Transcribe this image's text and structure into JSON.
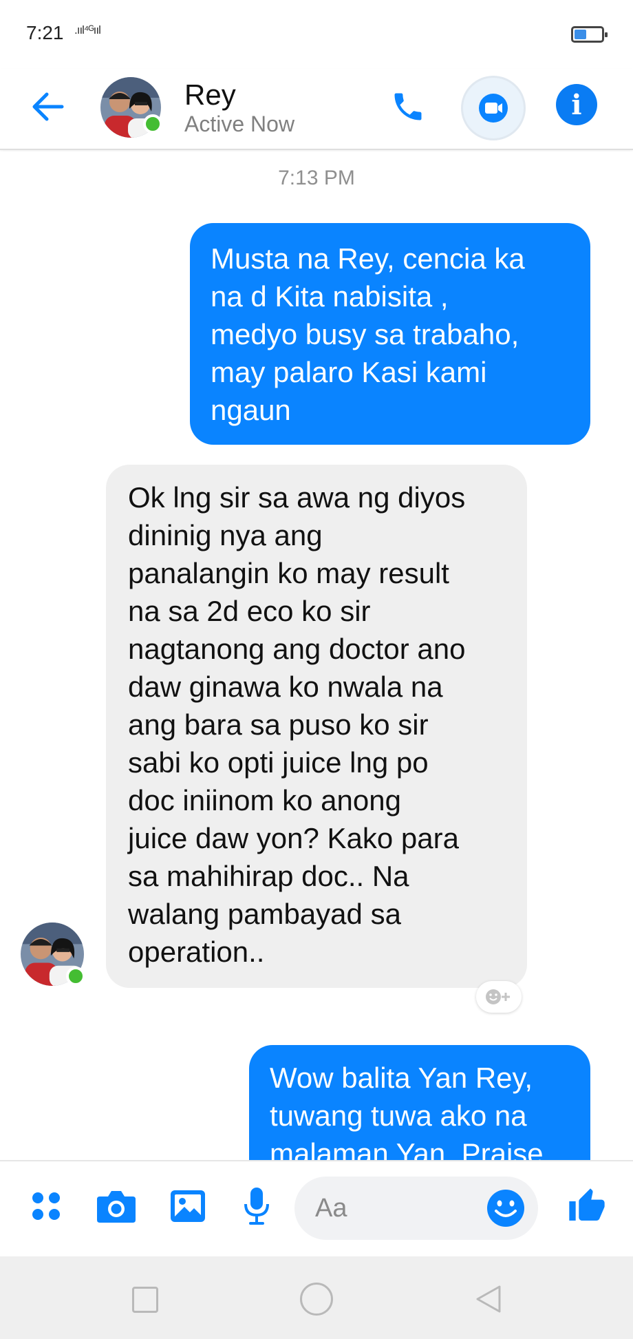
{
  "status_bar": {
    "time": "7:21",
    "signal": ".ııl⁴ᴳııl",
    "battery_level": 0.45
  },
  "header": {
    "contact_name": "Rey",
    "presence_status": "Active Now",
    "icons": {
      "back": "arrow-left-icon",
      "call": "phone-icon",
      "video": "video-camera-icon",
      "info": "info-icon"
    }
  },
  "conversation": {
    "timestamp": "7:13 PM",
    "messages": [
      {
        "direction": "outgoing",
        "lines": [
          "Musta na Rey, cencia ka",
          "na d Kita nabisita ,",
          "medyo busy sa trabaho,",
          "may palaro Kasi kami",
          "ngaun"
        ]
      },
      {
        "direction": "incoming",
        "lines": [
          "Ok lng sir sa awa ng diyos",
          "dininig nya ang",
          "panalangin ko may result",
          "na sa 2d eco ko sir",
          "nagtanong ang doctor ano",
          "daw ginawa ko nwala na",
          "ang bara sa puso ko sir",
          "sabi ko opti juice lng po",
          "doc iniinom ko anong",
          "juice daw yon?  Kako para",
          "sa mahihirap doc.. Na",
          "walang pambayad sa",
          "operation.."
        ]
      },
      {
        "direction": "outgoing",
        "lines": [
          "Wow balita Yan Rey,",
          "tuwang tuwa ako na",
          "malaman Yan. Praise"
        ]
      }
    ],
    "reaction_icon": "add-reaction-icon"
  },
  "composer": {
    "placeholder": "Aa",
    "icons": [
      "apps-grid-icon",
      "camera-icon",
      "gallery-icon",
      "microphone-icon",
      "emoji-icon",
      "thumbs-up-icon"
    ]
  },
  "colors": {
    "accent": "#0a84ff",
    "outgoing_bubble": "#0a84ff",
    "incoming_bubble": "#efefef",
    "presence": "#44bd32"
  }
}
